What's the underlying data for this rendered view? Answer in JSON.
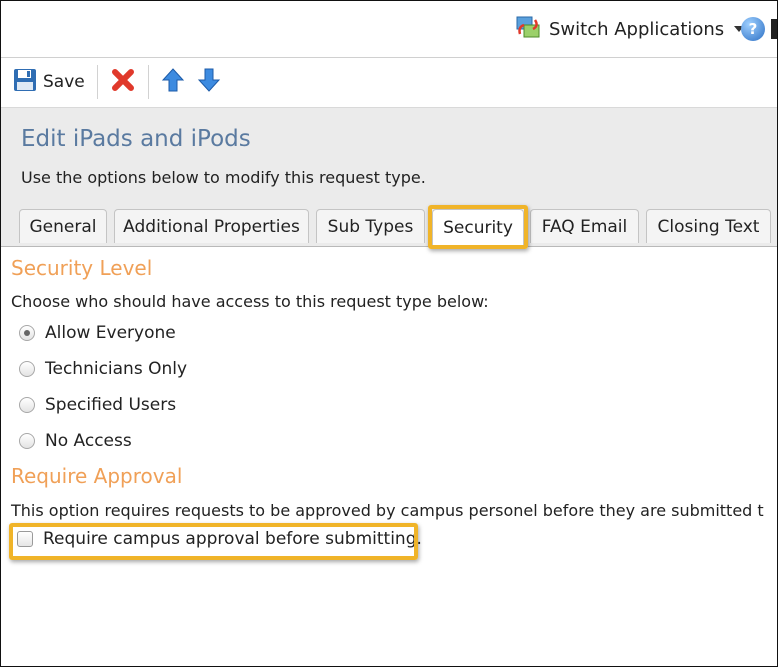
{
  "topbar": {
    "switch_label": "Switch Applications",
    "switch_icon": "switch-applications-icon",
    "help_icon": "help-icon",
    "help_glyph": "?"
  },
  "toolbar": {
    "save_label": "Save",
    "icons": [
      "floppy-disk-icon",
      "delete-x-icon",
      "arrow-up-icon",
      "arrow-down-icon"
    ]
  },
  "header": {
    "title": "Edit iPads and iPods",
    "subtitle": "Use the options below to modify this request type."
  },
  "tabs": [
    {
      "label": "General",
      "active": false
    },
    {
      "label": "Additional Properties",
      "active": false
    },
    {
      "label": "Sub Types",
      "active": false
    },
    {
      "label": "Security",
      "active": true
    },
    {
      "label": "FAQ Email",
      "active": false
    },
    {
      "label": "Closing Text",
      "active": false
    }
  ],
  "security_level": {
    "heading": "Security Level",
    "description": "Choose who should have access to this request type below:",
    "options": [
      {
        "label": "Allow Everyone",
        "checked": true
      },
      {
        "label": "Technicians Only",
        "checked": false
      },
      {
        "label": "Specified Users",
        "checked": false
      },
      {
        "label": "No Access",
        "checked": false
      }
    ]
  },
  "require_approval": {
    "heading": "Require Approval",
    "description": "This option requires requests to be approved by campus personel before they are submitted t",
    "checkbox_label": "Require campus approval before submitting.",
    "checked": false
  },
  "colors": {
    "title_blue": "#5a7aa0",
    "section_orange": "#f0a057",
    "highlight": "#f0b429",
    "header_gray": "#ebebeb"
  }
}
